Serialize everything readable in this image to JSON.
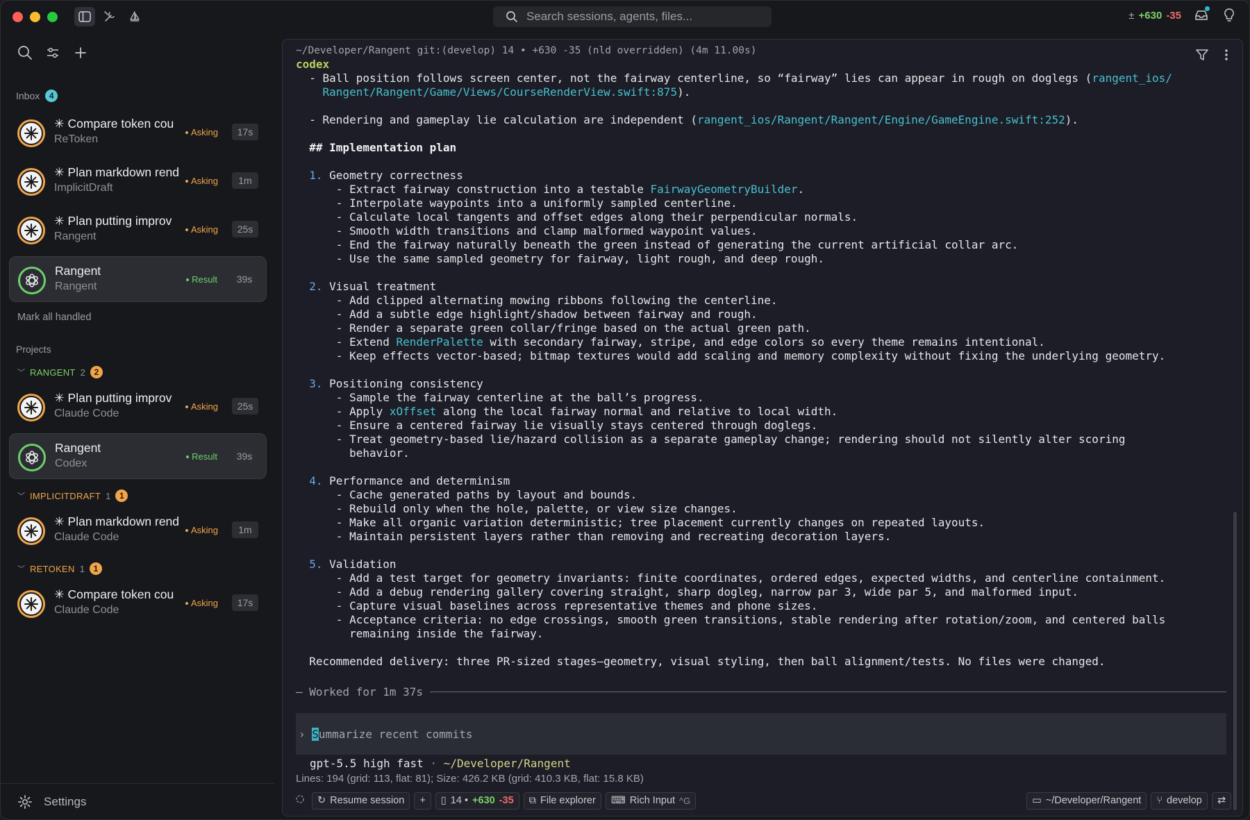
{
  "titlebar": {
    "search_placeholder": "Search sessions, agents, files...",
    "diff_added": "+630",
    "diff_removed": "-35"
  },
  "sidebar": {
    "inbox_label": "Inbox",
    "inbox_count": "4",
    "inbox_sessions": [
      {
        "title": "✳ Compare token cou",
        "subtitle": "ReToken",
        "status": "Asking",
        "time": "17s",
        "agent": "claude"
      },
      {
        "title": "✳ Plan markdown rend",
        "subtitle": "ImplicitDraft",
        "status": "Asking",
        "time": "1m",
        "agent": "claude"
      },
      {
        "title": "✳ Plan putting improv",
        "subtitle": "Rangent",
        "status": "Asking",
        "time": "25s",
        "agent": "claude"
      },
      {
        "title": "Rangent",
        "subtitle": "Rangent",
        "status": "Result",
        "time": "39s",
        "agent": "codex"
      }
    ],
    "mark_all_handled": "Mark all handled",
    "projects_label": "Projects",
    "projects": [
      {
        "name": "RANGENT",
        "count": "2",
        "badge": "2",
        "sessions": [
          {
            "title": "✳ Plan putting improv",
            "subtitle": "Claude Code",
            "status": "Asking",
            "time": "25s",
            "agent": "claude"
          },
          {
            "title": "Rangent",
            "subtitle": "Codex",
            "status": "Result",
            "time": "39s",
            "agent": "codex"
          }
        ]
      },
      {
        "name": "IMPLICITDRAFT",
        "count": "1",
        "badge": "1",
        "sessions": [
          {
            "title": "✳ Plan markdown rend",
            "subtitle": "Claude Code",
            "status": "Asking",
            "time": "1m",
            "agent": "claude"
          }
        ]
      },
      {
        "name": "RETOKEN",
        "count": "1",
        "badge": "1",
        "sessions": [
          {
            "title": "✳ Compare token cou",
            "subtitle": "Claude Code",
            "status": "Asking",
            "time": "17s",
            "agent": "claude"
          }
        ]
      }
    ],
    "settings_label": "Settings"
  },
  "terminal": {
    "cwd_line": "~/Developer/Rangent git:(develop) 14 • +630 -35 (nld overridden) (4m 11.00s)",
    "agent_label": "codex",
    "worked_for": "Worked for 1m 37s",
    "input_first_char": "S",
    "input_rest": "ummarize recent commits",
    "model": "gpt-5.5 high fast",
    "model_sep": "·",
    "model_path": "~/Developer/Rangent",
    "stats": "Lines: 194 (grid: 113, flat: 81); Size: 426.2 KB (grid: 410.3 KB, flat: 15.8 KB)"
  },
  "statusbar": {
    "resume": "Resume session",
    "plus": "+",
    "changes_count": "14 •",
    "changes_added": "+630",
    "changes_removed": "-35",
    "file_explorer": "File explorer",
    "rich_input": "Rich Input",
    "rich_input_kbd": "^G",
    "path": "~/Developer/Rangent",
    "branch": "develop"
  },
  "colors": {
    "claude_ring": "#f0a54a",
    "codex_ring": "#6fcf6a",
    "link": "#48c0cf",
    "heading_number": "#6aa7e8"
  }
}
